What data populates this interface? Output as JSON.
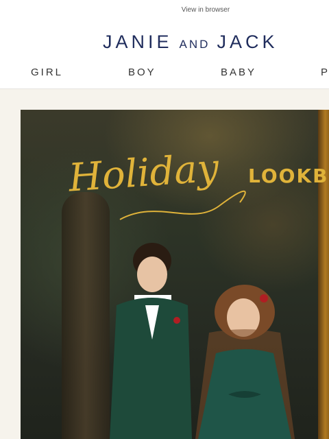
{
  "preheader": {
    "view_in_browser": "View in browser"
  },
  "brand": {
    "name_left": "JANIE",
    "name_and": "AND",
    "name_right": "JACK"
  },
  "nav": {
    "items": [
      "GIRL",
      "BOY",
      "BABY",
      "PA"
    ]
  },
  "hero": {
    "script_title": "Holiday",
    "title": "LOOKBOO"
  },
  "colors": {
    "brand_navy": "#1f2c5c",
    "gold": "#e0b33a",
    "velvet_green": "#1e4a3a",
    "cream": "#f6f3ec"
  }
}
